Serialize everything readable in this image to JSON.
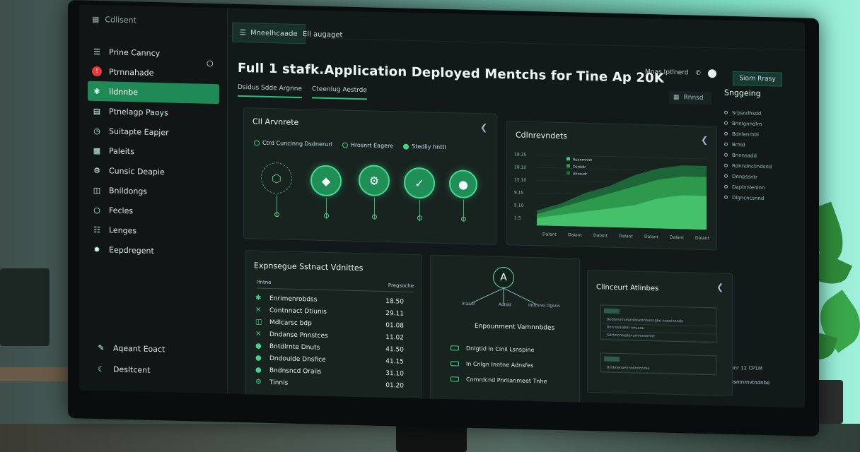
{
  "app": {
    "brand": "Cdlisent"
  },
  "sidebar": {
    "items": [
      {
        "label": "Prine Canncy",
        "icon": "bars-icon"
      },
      {
        "label": "Ptrnnahade",
        "icon": "alert-icon"
      },
      {
        "label": "Ildnnbe",
        "icon": "gear-icon"
      },
      {
        "label": "Ptnelagp Paoys",
        "icon": "folder-icon"
      },
      {
        "label": "Suitapte Eapjer",
        "icon": "clock-icon"
      },
      {
        "label": "Paleits",
        "icon": "grid-icon"
      },
      {
        "label": "Cunsic Deapie",
        "icon": "cog-icon"
      },
      {
        "label": "Bnildongs",
        "icon": "build-icon"
      },
      {
        "label": "Fecles",
        "icon": "circle-icon"
      },
      {
        "label": "Lenges",
        "icon": "list-icon"
      },
      {
        "label": "Eepdregent",
        "icon": "settings-icon"
      }
    ],
    "bottom": [
      {
        "label": "Aqeant Eoact",
        "icon": "pen-icon"
      },
      {
        "label": "Desltcent",
        "icon": "moon-icon"
      }
    ]
  },
  "header": {
    "tabs": [
      "Mneelhcaade",
      "Ell augaget"
    ],
    "title": "Full 1 stafk.Application Deployed Mentchs for Tine Ap 20K",
    "sub_tabs": [
      "Dsidus Sdde Argnne",
      "Cteenlug Aestrde"
    ],
    "right_text": "Mnas Iptlnerd",
    "action_button": "Siorn Rrasy",
    "secondary_button": "Rnnsd"
  },
  "ci": {
    "title": "CII Arvnrete",
    "legend": [
      "Ctrd Cuncinng Dsdnerurl",
      "Hrosnrt Eagere",
      "Stedily hnttl"
    ]
  },
  "chart": {
    "title": "Cdlnrevndets",
    "legend": [
      "Ruenrnnnh",
      "Dsrstdr",
      "Ahnrudr"
    ],
    "colors": {
      "back": "#1e6a3b",
      "mid": "#2e9c4e",
      "front": "#46c36b"
    }
  },
  "chart_data": {
    "type": "area",
    "title": "Cdlnrevndets",
    "categories": [
      "Dalant",
      "Dalant",
      "Dalant",
      "Dalant",
      "Dalant",
      "Dalant",
      "Dalant"
    ],
    "y_ticks": [
      "18.35",
      "18.10",
      "15.10",
      "9.15",
      "5.10",
      "1.5"
    ],
    "series": [
      {
        "name": "Ruenrnnnh",
        "values": [
          4,
          6,
          9,
          11,
          14,
          16,
          17,
          17
        ]
      },
      {
        "name": "Dsrstdr",
        "values": [
          3,
          5,
          7,
          9,
          11,
          13,
          14,
          14
        ]
      },
      {
        "name": "Ahnrudr",
        "values": [
          2,
          3,
          4,
          5,
          6,
          8,
          9,
          9
        ]
      }
    ],
    "ylim": [
      0,
      20
    ]
  },
  "deps": {
    "title": "Expnsegue Sstnact Vdnittes",
    "col_name": "Ifntne",
    "col_value": "Pregsoche",
    "rows": [
      {
        "name": "Enrimenrobdss",
        "value": "18.50"
      },
      {
        "name": "Contnnact Dtiunis",
        "value": "29.11"
      },
      {
        "name": "Mdlcarsc bdp",
        "value": "01.08"
      },
      {
        "name": "Dndanse Pnnstces",
        "value": "11.02"
      },
      {
        "name": "Bntdlrnte Dnuts",
        "value": "41.50"
      },
      {
        "name": "Dndoulde Dnsfice",
        "value": "41.15"
      },
      {
        "name": "Bndnsncd Oraiis",
        "value": "31.10"
      },
      {
        "name": "Tinnis",
        "value": "01.20"
      }
    ]
  },
  "env": {
    "hub": "A",
    "nodes": [
      "Inaadl",
      "Adtdd",
      "Imnnnsi Dgsnn"
    ],
    "title": "Enpounment Vamnnbdes",
    "items": [
      "Dnlgtid ln Cinil Lsnspine",
      "In Cnlgn Inntne Adnsfes",
      "Cnmrdcnd Pnrilanmeet Tnhe"
    ]
  },
  "cert": {
    "title": "Cllnceurt Atlinbes",
    "rows_a": [
      "Bedhnsnmeardeeastnnanngbe nnaulnenda",
      "Bnn nsnsdeh nnuaau",
      "Sdrhnnneedenurhmnsenhe"
    ],
    "rows_b": [
      "Brnhnenaeirnnlinnhnme"
    ]
  },
  "rpanel": {
    "title": "Snggeing",
    "items": [
      "Srpsndhsdd",
      "Bnnlgnndlrn",
      "Bdnlenrnbl",
      "Brnld",
      "Bnnnsadd",
      "Rdnndnclindsnd",
      "Dnnpssntr",
      "Daplnnlenlnn",
      "Dlgncncsnnd"
    ],
    "foot": "Anpnr 12 CP1M",
    "foot2": "Snnsmnrnvtndnbe"
  }
}
